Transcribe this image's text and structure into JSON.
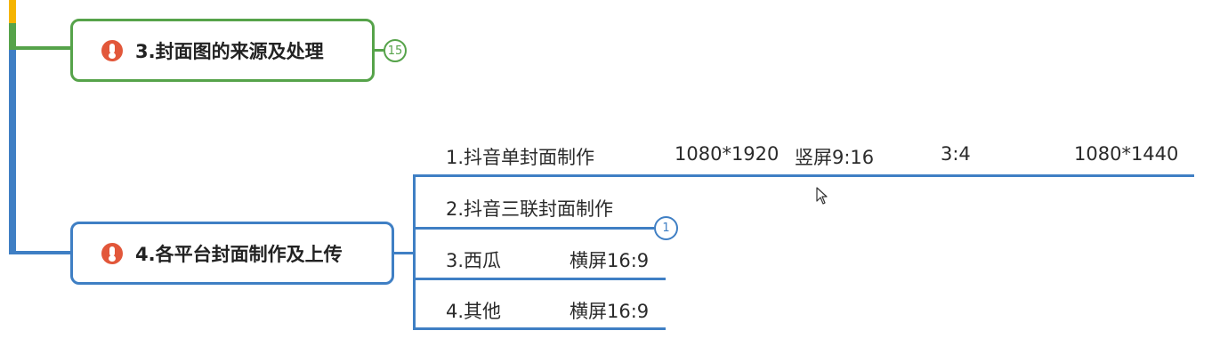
{
  "topics": [
    {
      "label": "3.封面图的来源及处理",
      "badge": "15",
      "color": "#56a34a"
    },
    {
      "label": "4.各平台封面制作及上传",
      "badge": "1",
      "color": "#3f7fc4"
    }
  ],
  "subtopics": [
    {
      "label": "1.抖音单封面制作",
      "notes": [
        "1080*1920",
        "竖屏9:16",
        "3:4",
        "1080*1440"
      ]
    },
    {
      "label": "2.抖音三联封面制作"
    },
    {
      "label": "3.西瓜",
      "notes": [
        "横屏16:9"
      ]
    },
    {
      "label": "4.其他",
      "notes": [
        "横屏16:9"
      ]
    }
  ],
  "colors": {
    "green": "#56a34a",
    "blue": "#3f7fc4",
    "yellow": "#f5b400",
    "icon": "#e2573a"
  },
  "icons": {
    "topic_icon": "thermometer-icon",
    "cursor": "mouse-cursor-icon"
  }
}
